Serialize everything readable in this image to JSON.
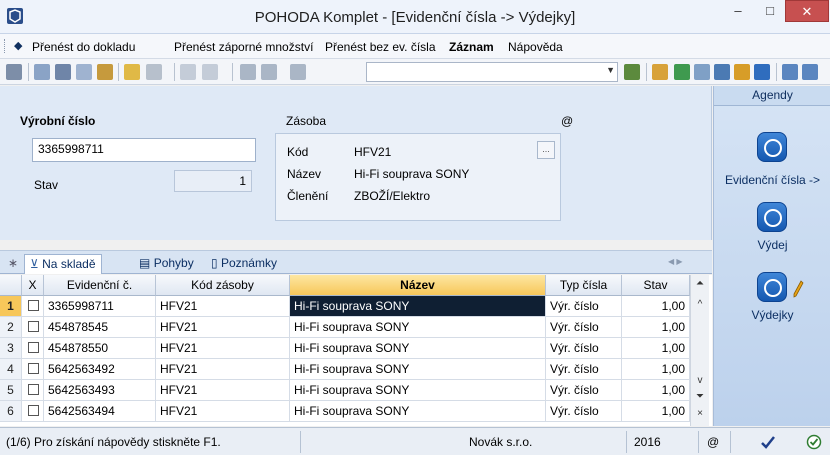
{
  "window": {
    "title": "POHODA Komplet - [Evidenční čísla -> Výdejky]",
    "min_label": "–",
    "max_label": "□",
    "close_label": "✕"
  },
  "menu": {
    "arrow": "◆",
    "items": [
      {
        "label": "Přenést do dokladu",
        "bold": false
      },
      {
        "label": "Přenést záporné množství",
        "bold": false
      },
      {
        "label": "Přenést bez ev. čísla",
        "bold": false
      },
      {
        "label": "Záznam",
        "bold": true
      },
      {
        "label": "Nápověda",
        "bold": false
      }
    ]
  },
  "form": {
    "vyrobni_cislo_label": "Výrobní číslo",
    "vyrobni_cislo_value": "3365998711",
    "stav_label": "Stav",
    "stav_value": "1",
    "zasoba_label": "Zásoba",
    "at_sign": "@",
    "kod_label": "Kód",
    "kod_value": "HFV21",
    "nazev_label": "Název",
    "nazev_value": "Hi-Fi souprava SONY",
    "cleneni_label": "Členění",
    "cleneni_value": "ZBOŽÍ/Elektro",
    "dots_label": "..."
  },
  "agenda": {
    "header": "Agendy",
    "items": [
      {
        "label": "Evidenční čísla ->",
        "icon": "pohoda-agenda-icon"
      },
      {
        "label": "Výdej",
        "icon": "pohoda-agenda-icon"
      },
      {
        "label": "Výdejky",
        "icon": "pohoda-agenda-edit-icon"
      }
    ]
  },
  "tabs": {
    "star": "∗",
    "items": [
      {
        "label": "Na skladě",
        "active": true
      },
      {
        "label": "Pohyby",
        "active": false
      },
      {
        "label": "Poznámky",
        "active": false
      }
    ]
  },
  "grid": {
    "columns": [
      "X",
      "Evidenční č.",
      "Kód zásoby",
      "Název",
      "Typ čísla",
      "Stav"
    ],
    "sorted_column": "Název",
    "rows": [
      {
        "num": "1",
        "ev": "3365998711",
        "kod": "HFV21",
        "nazev": "Hi-Fi souprava SONY",
        "typ": "Výr. číslo",
        "stav": "1,00"
      },
      {
        "num": "2",
        "ev": "454878545",
        "kod": "HFV21",
        "nazev": "Hi-Fi souprava SONY",
        "typ": "Výr. číslo",
        "stav": "1,00"
      },
      {
        "num": "3",
        "ev": "454878550",
        "kod": "HFV21",
        "nazev": "Hi-Fi souprava SONY",
        "typ": "Výr. číslo",
        "stav": "1,00"
      },
      {
        "num": "4",
        "ev": "5642563492",
        "kod": "HFV21",
        "nazev": "Hi-Fi souprava SONY",
        "typ": "Výr. číslo",
        "stav": "1,00"
      },
      {
        "num": "5",
        "ev": "5642563493",
        "kod": "HFV21",
        "nazev": "Hi-Fi souprava SONY",
        "typ": "Výr. číslo",
        "stav": "1,00"
      },
      {
        "num": "6",
        "ev": "5642563494",
        "kod": "HFV21",
        "nazev": "Hi-Fi souprava SONY",
        "typ": "Výr. číslo",
        "stav": "1,00"
      }
    ]
  },
  "status": {
    "help": "(1/6) Pro získání nápovědy stiskněte F1.",
    "company": "Novák s.r.o.",
    "year": "2016",
    "at_sign": "@"
  },
  "colors": {
    "accent": "#f7c75a",
    "selection": "#0f1f33",
    "agenda_blue": "#1558b0",
    "close_red": "#c75050"
  }
}
